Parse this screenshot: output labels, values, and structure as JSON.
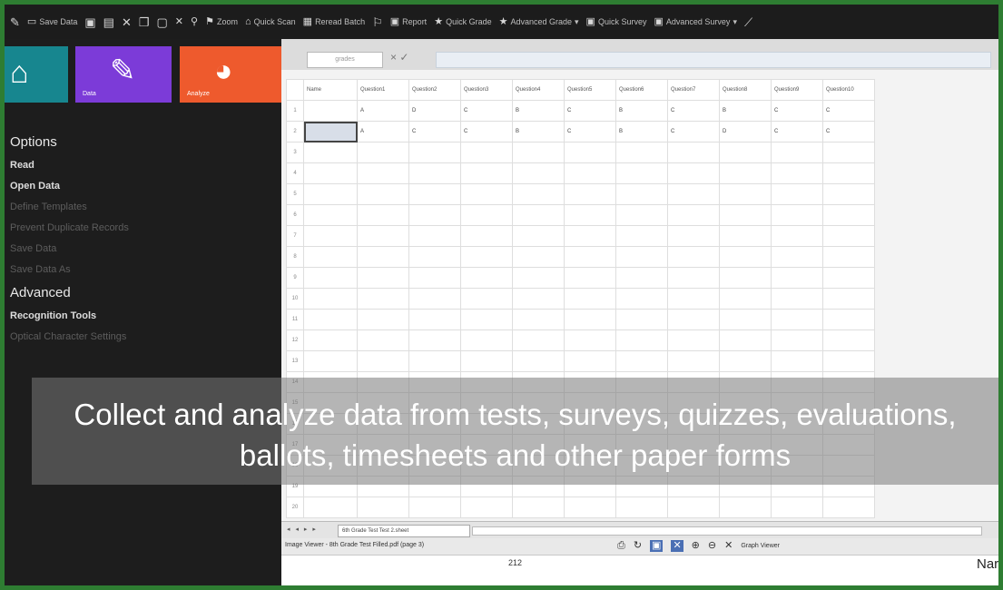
{
  "toolbar": {
    "items": [
      {
        "icon": "pencil-icon",
        "label": ""
      },
      {
        "icon": "save-icon",
        "label": "Save Data"
      },
      {
        "icon": "grid-icon",
        "label": ""
      },
      {
        "icon": "cut-icon",
        "label": ""
      },
      {
        "icon": "copy-icon",
        "label": ""
      },
      {
        "icon": "paste-icon",
        "label": ""
      },
      {
        "icon": "close-icon",
        "label": ""
      },
      {
        "icon": "search-icon",
        "label": ""
      },
      {
        "icon": "zoom-icon",
        "label": "Zoom"
      },
      {
        "icon": "grade-icon",
        "label": "Quick Scan"
      },
      {
        "icon": "batch-icon",
        "label": "Reread Batch"
      },
      {
        "icon": "flag-icon",
        "label": ""
      },
      {
        "icon": "report-icon",
        "label": "Report"
      },
      {
        "icon": "star-icon",
        "label": "Quick Grade"
      },
      {
        "icon": "star-icon",
        "label": "Advanced Grade"
      },
      {
        "icon": "survey-icon",
        "label": "Quick Survey"
      },
      {
        "icon": "survey-icon",
        "label": "Advanced Survey"
      },
      {
        "icon": "wand-icon",
        "label": ""
      }
    ]
  },
  "tiles": {
    "home_label": "",
    "edit_label": "Data",
    "chart_label": "Analyze"
  },
  "menu": {
    "items": [
      {
        "label": "Options",
        "style": "head"
      },
      {
        "label": "Read",
        "style": "bold"
      },
      {
        "label": "Open Data",
        "style": "bold"
      },
      {
        "label": "Define Templates",
        "style": "dim"
      },
      {
        "label": "Prevent Duplicate Records",
        "style": "dim"
      },
      {
        "label": "Save Data",
        "style": "dim"
      },
      {
        "label": "Save Data As",
        "style": "dim"
      },
      {
        "label": "Advanced",
        "style": "head"
      },
      {
        "label": "Recognition Tools",
        "style": "bold"
      },
      {
        "label": "Optical Character Settings",
        "style": "dim"
      }
    ]
  },
  "formula": {
    "name_box": "grades",
    "fx": "× ✓"
  },
  "grid": {
    "headers": [
      "Name",
      "Question1",
      "Question2",
      "Question3",
      "Question4",
      "Question5",
      "Question6",
      "Question7",
      "Question8",
      "Question9",
      "Question10"
    ],
    "rows": [
      [
        "",
        "A",
        "D",
        "C",
        "B",
        "C",
        "B",
        "C",
        "B",
        "C",
        "C"
      ],
      [
        "",
        "A",
        "C",
        "C",
        "B",
        "C",
        "B",
        "C",
        "D",
        "C",
        "C"
      ],
      [
        "",
        "",
        "",
        "",
        "",
        "",
        "",
        "",
        "",
        "",
        ""
      ],
      [
        "",
        "",
        "",
        "",
        "",
        "",
        "",
        "",
        "",
        "",
        ""
      ],
      [
        "",
        "",
        "",
        "",
        "",
        "",
        "",
        "",
        "",
        "",
        ""
      ],
      [
        "",
        "",
        "",
        "",
        "",
        "",
        "",
        "",
        "",
        "",
        ""
      ],
      [
        "",
        "",
        "",
        "",
        "",
        "",
        "",
        "",
        "",
        "",
        ""
      ],
      [
        "",
        "",
        "",
        "",
        "",
        "",
        "",
        "",
        "",
        "",
        ""
      ],
      [
        "",
        "",
        "",
        "",
        "",
        "",
        "",
        "",
        "",
        "",
        ""
      ],
      [
        "",
        "",
        "",
        "",
        "",
        "",
        "",
        "",
        "",
        "",
        ""
      ],
      [
        "",
        "",
        "",
        "",
        "",
        "",
        "",
        "",
        "",
        "",
        ""
      ],
      [
        "",
        "",
        "",
        "",
        "",
        "",
        "",
        "",
        "",
        "",
        ""
      ],
      [
        "",
        "",
        "",
        "",
        "",
        "",
        "",
        "",
        "",
        "",
        ""
      ],
      [
        "",
        "",
        "",
        "",
        "",
        "",
        "",
        "",
        "",
        "",
        ""
      ],
      [
        "",
        "",
        "",
        "",
        "",
        "",
        "",
        "",
        "",
        "",
        ""
      ],
      [
        "",
        "",
        "",
        "",
        "",
        "",
        "",
        "",
        "",
        "",
        ""
      ],
      [
        "",
        "",
        "",
        "",
        "",
        "",
        "",
        "",
        "",
        "",
        ""
      ],
      [
        "",
        "",
        "",
        "",
        "",
        "",
        "",
        "",
        "",
        "",
        ""
      ],
      [
        "",
        "",
        "",
        "",
        "",
        "",
        "",
        "",
        "",
        "",
        ""
      ],
      [
        "",
        "",
        "",
        "",
        "",
        "",
        "",
        "",
        "",
        "",
        ""
      ]
    ],
    "row_numbers": [
      "1",
      "2",
      "3",
      "4",
      "5",
      "6",
      "7",
      "8",
      "9",
      "10",
      "11",
      "12",
      "13",
      "14",
      "15",
      "16",
      "17",
      "18",
      "19",
      "20"
    ]
  },
  "sheet": {
    "nav": "◂ ◂ ▸ ▸",
    "tab": "6th Grade Test Test 2.sheet"
  },
  "viewer": {
    "title": "Image Viewer - 8th Grade Test Filled.pdf  (page 3)",
    "graph_label": "Graph Viewer",
    "doc_text": "212",
    "doc_name": "Nar"
  },
  "caption": {
    "line1": "Collect and analyze data from tests, surveys, quizzes, evaluations,",
    "line2": "ballots, timesheets and other paper forms"
  },
  "colors": {
    "home_tile": "#17868f",
    "edit_tile": "#7c3bd8",
    "chart_tile": "#ee5a2d",
    "frame": "#2e7d32"
  }
}
